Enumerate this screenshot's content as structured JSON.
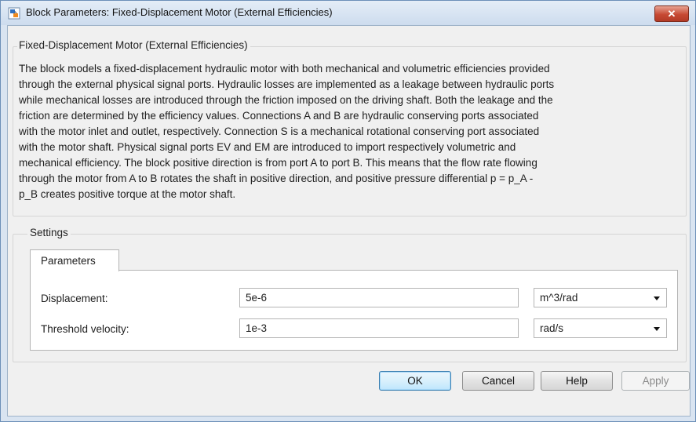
{
  "window": {
    "title": "Block Parameters: Fixed-Displacement Motor (External Efficiencies)",
    "close_label": "✕"
  },
  "block": {
    "group_title": "Fixed-Displacement Motor (External Efficiencies)",
    "description_lines": [
      "The block models a fixed-displacement hydraulic motor with both mechanical and volumetric efficiencies provided",
      "through the external physical signal ports. Hydraulic losses are implemented as a leakage between hydraulic ports",
      "while mechanical losses are introduced through the friction imposed on the driving shaft. Both the leakage and the",
      "friction are determined by the efficiency values. Connections A and B are hydraulic conserving ports associated",
      "with the motor inlet and outlet, respectively. Connection S is a mechanical rotational conserving port associated",
      "with the motor shaft. Physical signal ports EV and EM are introduced to import respectively volumetric and",
      "mechanical efficiency. The block positive direction is from port A to port B. This means that the flow rate flowing",
      "through the motor from A to B rotates the shaft in positive direction, and positive pressure differential p = p_A -",
      "p_B creates positive torque at the motor shaft."
    ]
  },
  "settings": {
    "group_title": "Settings",
    "tabs": [
      {
        "label": "Parameters"
      }
    ],
    "params": [
      {
        "label": "Displacement:",
        "value": "5e-6",
        "unit": "m^3/rad"
      },
      {
        "label": "Threshold velocity:",
        "value": "1e-3",
        "unit": "rad/s"
      }
    ]
  },
  "buttons": {
    "ok": "OK",
    "cancel": "Cancel",
    "help": "Help",
    "apply": "Apply"
  },
  "colors": {
    "accent": "#3c7fb1",
    "close": "#c74a34"
  }
}
